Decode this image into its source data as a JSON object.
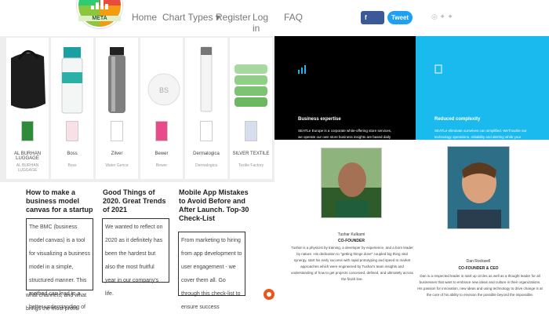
{
  "brand": {
    "logo_text": "META"
  },
  "nav": {
    "items": [
      "Home",
      "Chart Types ▾",
      "Register",
      "Log in",
      "FAQ"
    ]
  },
  "share": {
    "facebook": "Share",
    "twitter": "Tweet",
    "misc": "◎ ✦ ✦"
  },
  "products": [
    {
      "name": "AL BURHAN LUGGAGE",
      "sub": "AL BURHAN LUGGAGE",
      "image": "black-bag-icon"
    },
    {
      "name": "Boss",
      "sub": "Boss",
      "image": "bottle-icon"
    },
    {
      "name": "Zilver",
      "sub": "Water Gence",
      "image": "tumbler-icon"
    },
    {
      "name": "Bewer",
      "sub": "Bewer",
      "image": "fan-icon"
    },
    {
      "name": "Dermalogica",
      "sub": "Dermalogica",
      "image": "cosmetic-icon"
    },
    {
      "name": "SILVER TEXTILE",
      "sub": "Textile Factory",
      "image": "towels-icon"
    }
  ],
  "articles": [
    {
      "title": "How to make a business model canvas for a startup",
      "body": "The BMC (business model canvas) is a tool for visualizing a business model in a simple, structured manner. This method can lead to a better understanding of your clients, how product innovations are distributed through",
      "tail": "what channels, and what brings the most profit."
    },
    {
      "title": "Good Things of 2020. Great Trends of 2021",
      "body": "We wanted to reflect on 2020 as it definitely has been the hardest but also the most fruitful year in our company's life."
    },
    {
      "title": "Mobile App Mistakes to Avoid Before and After Launch. Top-30 Check-List",
      "body": "From marketing to hiring from app development to user engagement - we cover them all. Go through this check-list to ensure success"
    }
  ],
  "features": [
    {
      "title": "Business expertise",
      "body": "SEATLe Europe is a corporate white-offering store services, we operate our own store business insights are based daily and enhanced by knowledge sharing with customers."
    },
    {
      "title": "Reduced complexity",
      "body": "SEATLe eliminate ourselves can simplified. We'll tackle our technology operations, reliability and alerting while your focus is on what really differentiates your business."
    }
  ],
  "team": [
    {
      "name": "Tushar Kulkarni",
      "role": "CO-FOUNDER",
      "bio": "Tushar is a physicist by training, a developer by experience, and a born leader by nature. His dedication to \"getting things done\" coupled big thing vital synergy, start his early success with rapid prototyping and speed to market approaches which were engineered by Tushar's team insights and understanding of how to get projects conceived, defined, and ultimately across the finish line."
    },
    {
      "name": "Dan Rockwell",
      "role": "CO-FOUNDER & CEO",
      "bio": "Dan is a respected leader in start up circles as well as a thought leader for all businesses that want to embrace new ideas and culture in their organizations. His passion for innovation, new ideas and using technology to drive change is at the core of his ability to envision the possible beyond the impossible."
    }
  ],
  "colors": {
    "accent_blue": "#1ab9ee",
    "facebook": "#3b5998",
    "twitter": "#1da1f2",
    "float_button": "#e8581c"
  }
}
